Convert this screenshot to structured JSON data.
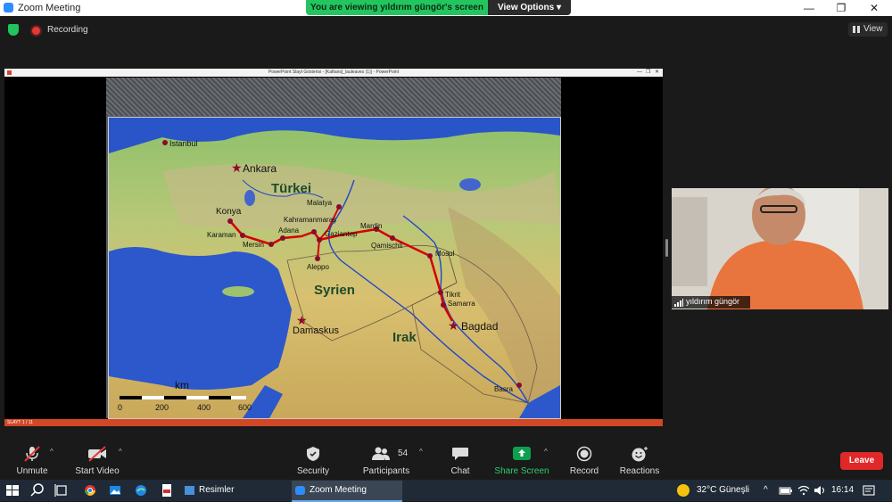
{
  "window": {
    "title": "Zoom Meeting",
    "minimize": "—",
    "restore": "❐",
    "close": "✕"
  },
  "banner": {
    "message": "You are viewing yıldırım güngör's screen",
    "options_label": "View Options",
    "options_caret": "▾"
  },
  "status": {
    "recording_label": "Recording",
    "view_label": "View"
  },
  "ppt": {
    "window_title": "PowerPoint Slayt Gösterisi - [Kaftans]_lauleaves (1)] - PowerPoint",
    "controls": [
      "—",
      "❐",
      "✕"
    ],
    "status_text": "SLAYT 1 / 11"
  },
  "map": {
    "labels": {
      "istanbul": "Istanbul",
      "ankara": "Ankara",
      "turkei": "Türkei",
      "konya": "Konya",
      "karaman": "Karaman",
      "mersin": "Mersin",
      "adana": "Adana",
      "malatya": "Malatya",
      "kahramanmaras": "Kahramanmaraş",
      "gaziantep": "Gaziantep",
      "mardin": "Mardin",
      "qamischli": "Qamischli",
      "mosul": "Mosul",
      "aleppo": "Aleppo",
      "syrien": "Syrien",
      "tikrit": "Tikrit",
      "samarra": "Samarra",
      "bagdad": "Bagdad",
      "damaskus": "Damaskus",
      "irak": "Irak",
      "basra": "Basra"
    },
    "scale": {
      "unit": "km",
      "ticks": [
        "0",
        "200",
        "400",
        "600"
      ]
    }
  },
  "participant": {
    "name": "yıldırım güngör"
  },
  "toolbar": {
    "unmute": "Unmute",
    "start_video": "Start Video",
    "security": "Security",
    "participants": "Participants",
    "participants_count": "54",
    "chat": "Chat",
    "share_screen": "Share Screen",
    "record": "Record",
    "reactions": "Reactions",
    "leave": "Leave",
    "caret": "^"
  },
  "taskbar": {
    "apps": [
      {
        "label": "Resimler"
      },
      {
        "label": "Zoom Meeting"
      }
    ],
    "weather": "32°C  Güneşli",
    "tray_caret": "^",
    "time": "16:14"
  },
  "colors": {
    "zoom_green": "#23c55e",
    "leave_red": "#e02828",
    "share_green": "#0e9f4f",
    "route_red": "#d40000",
    "ppt_orange": "#d24726",
    "taskbar": "#1f2a36"
  }
}
